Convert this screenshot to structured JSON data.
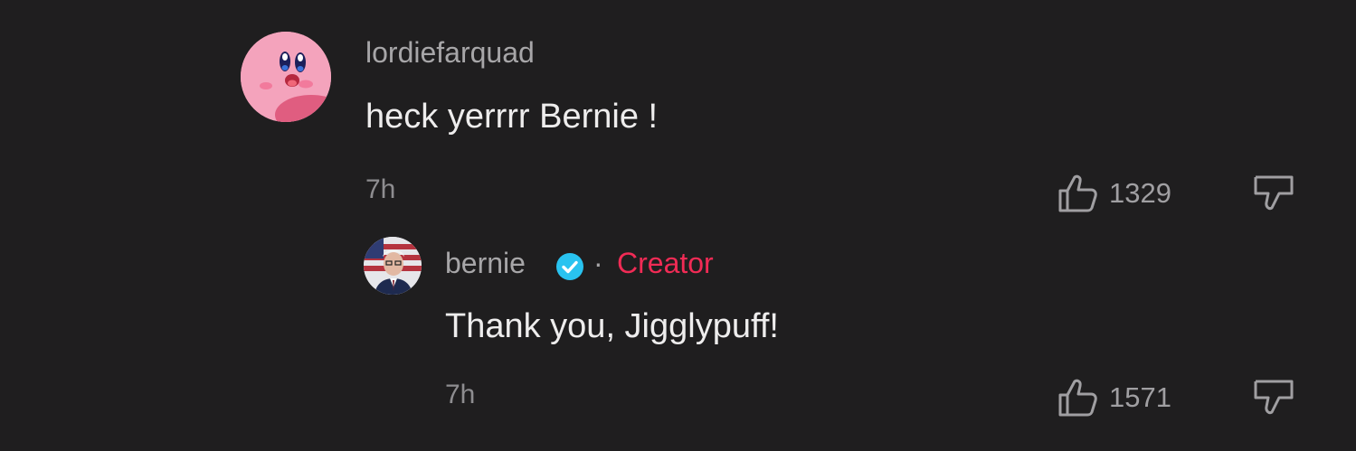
{
  "comment": {
    "username": "lordiefarquad",
    "text": "heck yerrrr Bernie !",
    "time": "7h",
    "likes": "1329",
    "avatar_icon": "pink-character-avatar"
  },
  "reply": {
    "username": "bernie",
    "verified_icon": "verified-check-icon",
    "separator": "·",
    "badge": "Creator",
    "text": "Thank you, Jigglypuff!",
    "time": "7h",
    "likes": "1571",
    "avatar_icon": "profile-photo-avatar"
  },
  "colors": {
    "background": "#1f1e1f",
    "creator_badge": "#f02b55",
    "verified": "#29c3f0"
  }
}
